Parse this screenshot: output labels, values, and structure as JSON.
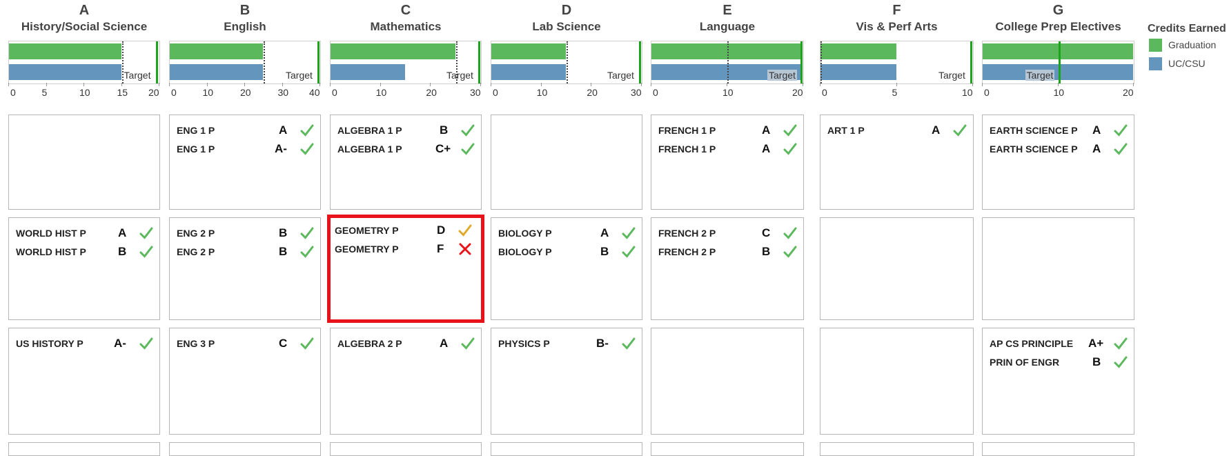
{
  "legend": {
    "title": "Credits Earned",
    "items": [
      {
        "label": "Graduation",
        "color": "#5cb85c"
      },
      {
        "label": "UC/CSU",
        "color": "#6495bd"
      }
    ]
  },
  "colors": {
    "graduation": "#5cb85c",
    "uc_csu": "#6495bd",
    "target": "#1aa51a",
    "highlight": "#e8121b",
    "check": "#5cb85c",
    "warn_check": "#e0a92b",
    "fail": "#e8121b"
  },
  "columns": [
    {
      "letter": "A",
      "title": "History/Social Science",
      "chart": {
        "max": 20,
        "ticks": [
          "0",
          "5",
          "10",
          "15",
          "20"
        ],
        "graduation": 15,
        "uc_csu": 15,
        "reference": 15,
        "target": 19.5,
        "target_label": "Target",
        "label_shaded": false
      },
      "rows": [
        [],
        [
          {
            "course": "WORLD HIST P",
            "grade": "A",
            "status": "check"
          },
          {
            "course": "WORLD HIST P",
            "grade": "B",
            "status": "check"
          }
        ],
        [
          {
            "course": "US HISTORY P",
            "grade": "A-",
            "status": "check"
          }
        ]
      ]
    },
    {
      "letter": "B",
      "title": "English",
      "chart": {
        "max": 40,
        "ticks": [
          "0",
          "10",
          "20",
          "30",
          "40"
        ],
        "graduation": 25,
        "uc_csu": 25,
        "reference": 25,
        "target": 39.5,
        "target_label": "Target",
        "label_shaded": false
      },
      "rows": [
        [
          {
            "course": "ENG 1 P",
            "grade": "A",
            "status": "check"
          },
          {
            "course": "ENG 1 P",
            "grade": "A-",
            "status": "check"
          }
        ],
        [
          {
            "course": "ENG 2 P",
            "grade": "B",
            "status": "check"
          },
          {
            "course": "ENG 2 P",
            "grade": "B",
            "status": "check"
          }
        ],
        [
          {
            "course": "ENG 3 P",
            "grade": "C",
            "status": "check"
          }
        ]
      ]
    },
    {
      "letter": "C",
      "title": "Mathematics",
      "chart": {
        "max": 30,
        "ticks": [
          "0",
          "10",
          "20",
          "30"
        ],
        "graduation": 25,
        "uc_csu": 15,
        "reference": 25,
        "target": 30,
        "target_label": "Target",
        "label_shaded": false
      },
      "rows": [
        [
          {
            "course": "ALGEBRA 1 P",
            "grade": "B",
            "status": "check"
          },
          {
            "course": "ALGEBRA 1 P",
            "grade": "C+",
            "status": "check"
          }
        ],
        [
          {
            "course": "GEOMETRY P",
            "grade": "D",
            "status": "warn"
          },
          {
            "course": "GEOMETRY P",
            "grade": "F",
            "status": "fail"
          }
        ],
        [
          {
            "course": "ALGEBRA 2 P",
            "grade": "A",
            "status": "check"
          }
        ]
      ]
    },
    {
      "letter": "D",
      "title": "Lab Science",
      "chart": {
        "max": 30,
        "ticks": [
          "0",
          "10",
          "20",
          "30"
        ],
        "graduation": 15,
        "uc_csu": 15,
        "reference": 15,
        "target": 30,
        "target_label": "Target",
        "label_shaded": false
      },
      "rows": [
        [],
        [
          {
            "course": "BIOLOGY P",
            "grade": "A",
            "status": "check"
          },
          {
            "course": "BIOLOGY P",
            "grade": "B",
            "status": "check"
          }
        ],
        [
          {
            "course": "PHYSICS P",
            "grade": "B-",
            "status": "check"
          }
        ]
      ]
    },
    {
      "letter": "E",
      "title": "Language",
      "chart": {
        "max": 20,
        "ticks": [
          "0",
          "10",
          "20"
        ],
        "graduation": 20,
        "uc_csu": 20,
        "reference": 10,
        "target": 20,
        "target_label": "Target",
        "label_shaded": true
      },
      "rows": [
        [
          {
            "course": "FRENCH 1 P",
            "grade": "A",
            "status": "check"
          },
          {
            "course": "FRENCH 1 P",
            "grade": "A",
            "status": "check"
          }
        ],
        [
          {
            "course": "FRENCH 2 P",
            "grade": "C",
            "status": "check"
          },
          {
            "course": "FRENCH 2 P",
            "grade": "B",
            "status": "check"
          }
        ],
        []
      ]
    },
    {
      "letter": "F",
      "title": "Vis & Perf Arts",
      "chart": {
        "max": 10,
        "ticks": [
          "0",
          "5",
          "10"
        ],
        "graduation": 5,
        "uc_csu": 5,
        "reference": 0,
        "target": 10,
        "target_label": "Target",
        "label_shaded": false
      },
      "rows": [
        [
          {
            "course": "ART 1 P",
            "grade": "A",
            "status": "check"
          }
        ],
        [],
        []
      ]
    },
    {
      "letter": "G",
      "title": "College Prep Electives",
      "chart": {
        "max": 20,
        "ticks": [
          "0",
          "10",
          "20"
        ],
        "graduation": 20,
        "uc_csu": 20,
        "reference": null,
        "target": 10,
        "target_label": "Target",
        "label_shaded": true
      },
      "rows": [
        [
          {
            "course": "EARTH SCIENCE P",
            "grade": "A",
            "status": "check"
          },
          {
            "course": "EARTH SCIENCE P",
            "grade": "A",
            "status": "check"
          }
        ],
        [],
        [
          {
            "course": "AP CS PRINCIPLE",
            "grade": "A+",
            "status": "check"
          },
          {
            "course": "PRIN OF ENGR",
            "grade": "B",
            "status": "check"
          }
        ]
      ]
    }
  ],
  "highlighted_cell": {
    "column": 2,
    "row": 1
  }
}
